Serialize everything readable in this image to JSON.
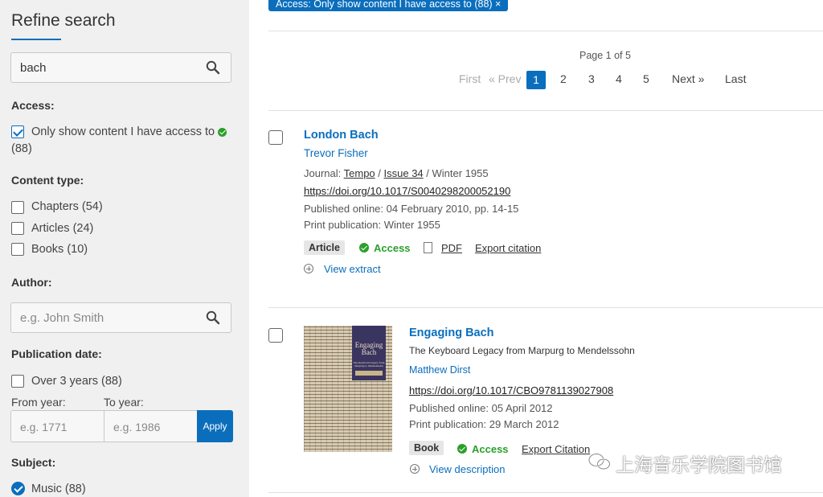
{
  "sidebar": {
    "title": "Refine search",
    "search": {
      "value": "bach"
    },
    "access": {
      "heading": "Access:",
      "option_label": "Only show content I have access to",
      "option_count": "(88)"
    },
    "content_type": {
      "heading": "Content type:",
      "options": [
        {
          "label": "Chapters (54)"
        },
        {
          "label": "Articles (24)"
        },
        {
          "label": "Books (10)"
        }
      ]
    },
    "author": {
      "heading": "Author:",
      "placeholder": "e.g. John Smith"
    },
    "publication_date": {
      "heading": "Publication date:",
      "option_label": "Over 3 years (88)",
      "from_label": "From year:",
      "to_label": "To year:",
      "from_placeholder": "e.g. 1771",
      "to_placeholder": "e.g. 1986",
      "apply_label": "Apply"
    },
    "subject": {
      "heading": "Subject:",
      "option_label": "Music (88)"
    }
  },
  "main": {
    "active_filter": "Access: Only show content I have access to (88) ×",
    "pagination": {
      "info": "Page 1 of 5",
      "first": "First",
      "prev": "« Prev",
      "current": "1",
      "pages": [
        "2",
        "3",
        "4",
        "5"
      ],
      "next": "Next »",
      "last": "Last"
    },
    "results": [
      {
        "title": "London Bach",
        "author": "Trevor Fisher",
        "journal_prefix": "Journal:",
        "journal": "Tempo",
        "issue": "Issue 34",
        "journal_suffix": "/ Winter 1955",
        "doi": "https://doi.org/10.1017/S0040298200052190",
        "published_online": "Published online: 04 February 2010, pp. 14-15",
        "print_publication": "Print publication: Winter 1955",
        "type_badge": "Article",
        "access_label": "Access",
        "pdf_label": "PDF",
        "export_label": "Export citation",
        "view_label": "View extract"
      },
      {
        "title": "Engaging Bach",
        "subtitle": "The Keyboard Legacy from Marpurg to Mendelssohn",
        "author": "Matthew Dirst",
        "doi": "https://doi.org/10.1017/CBO9781139027908",
        "published_online": "Published online: 05 April 2012",
        "print_publication": "Print publication: 29 March 2012",
        "type_badge": "Book",
        "access_label": "Access",
        "export_label": "Export Citation",
        "view_label": "View description",
        "cover": {
          "title": "Engaging Bach",
          "subtitle": "The Keyboard Legacy from Marpurg to Mendelssohn",
          "author": "Matthew Dirst",
          "series": "MUSICAL PERFORMANCE AND RECEPTION"
        }
      }
    ]
  },
  "watermark": "上海音乐学院图书馆",
  "colors": {
    "accent": "#0a6ebd",
    "access_green": "#2aa02a",
    "sidebar_bg": "#f0f0f0"
  }
}
